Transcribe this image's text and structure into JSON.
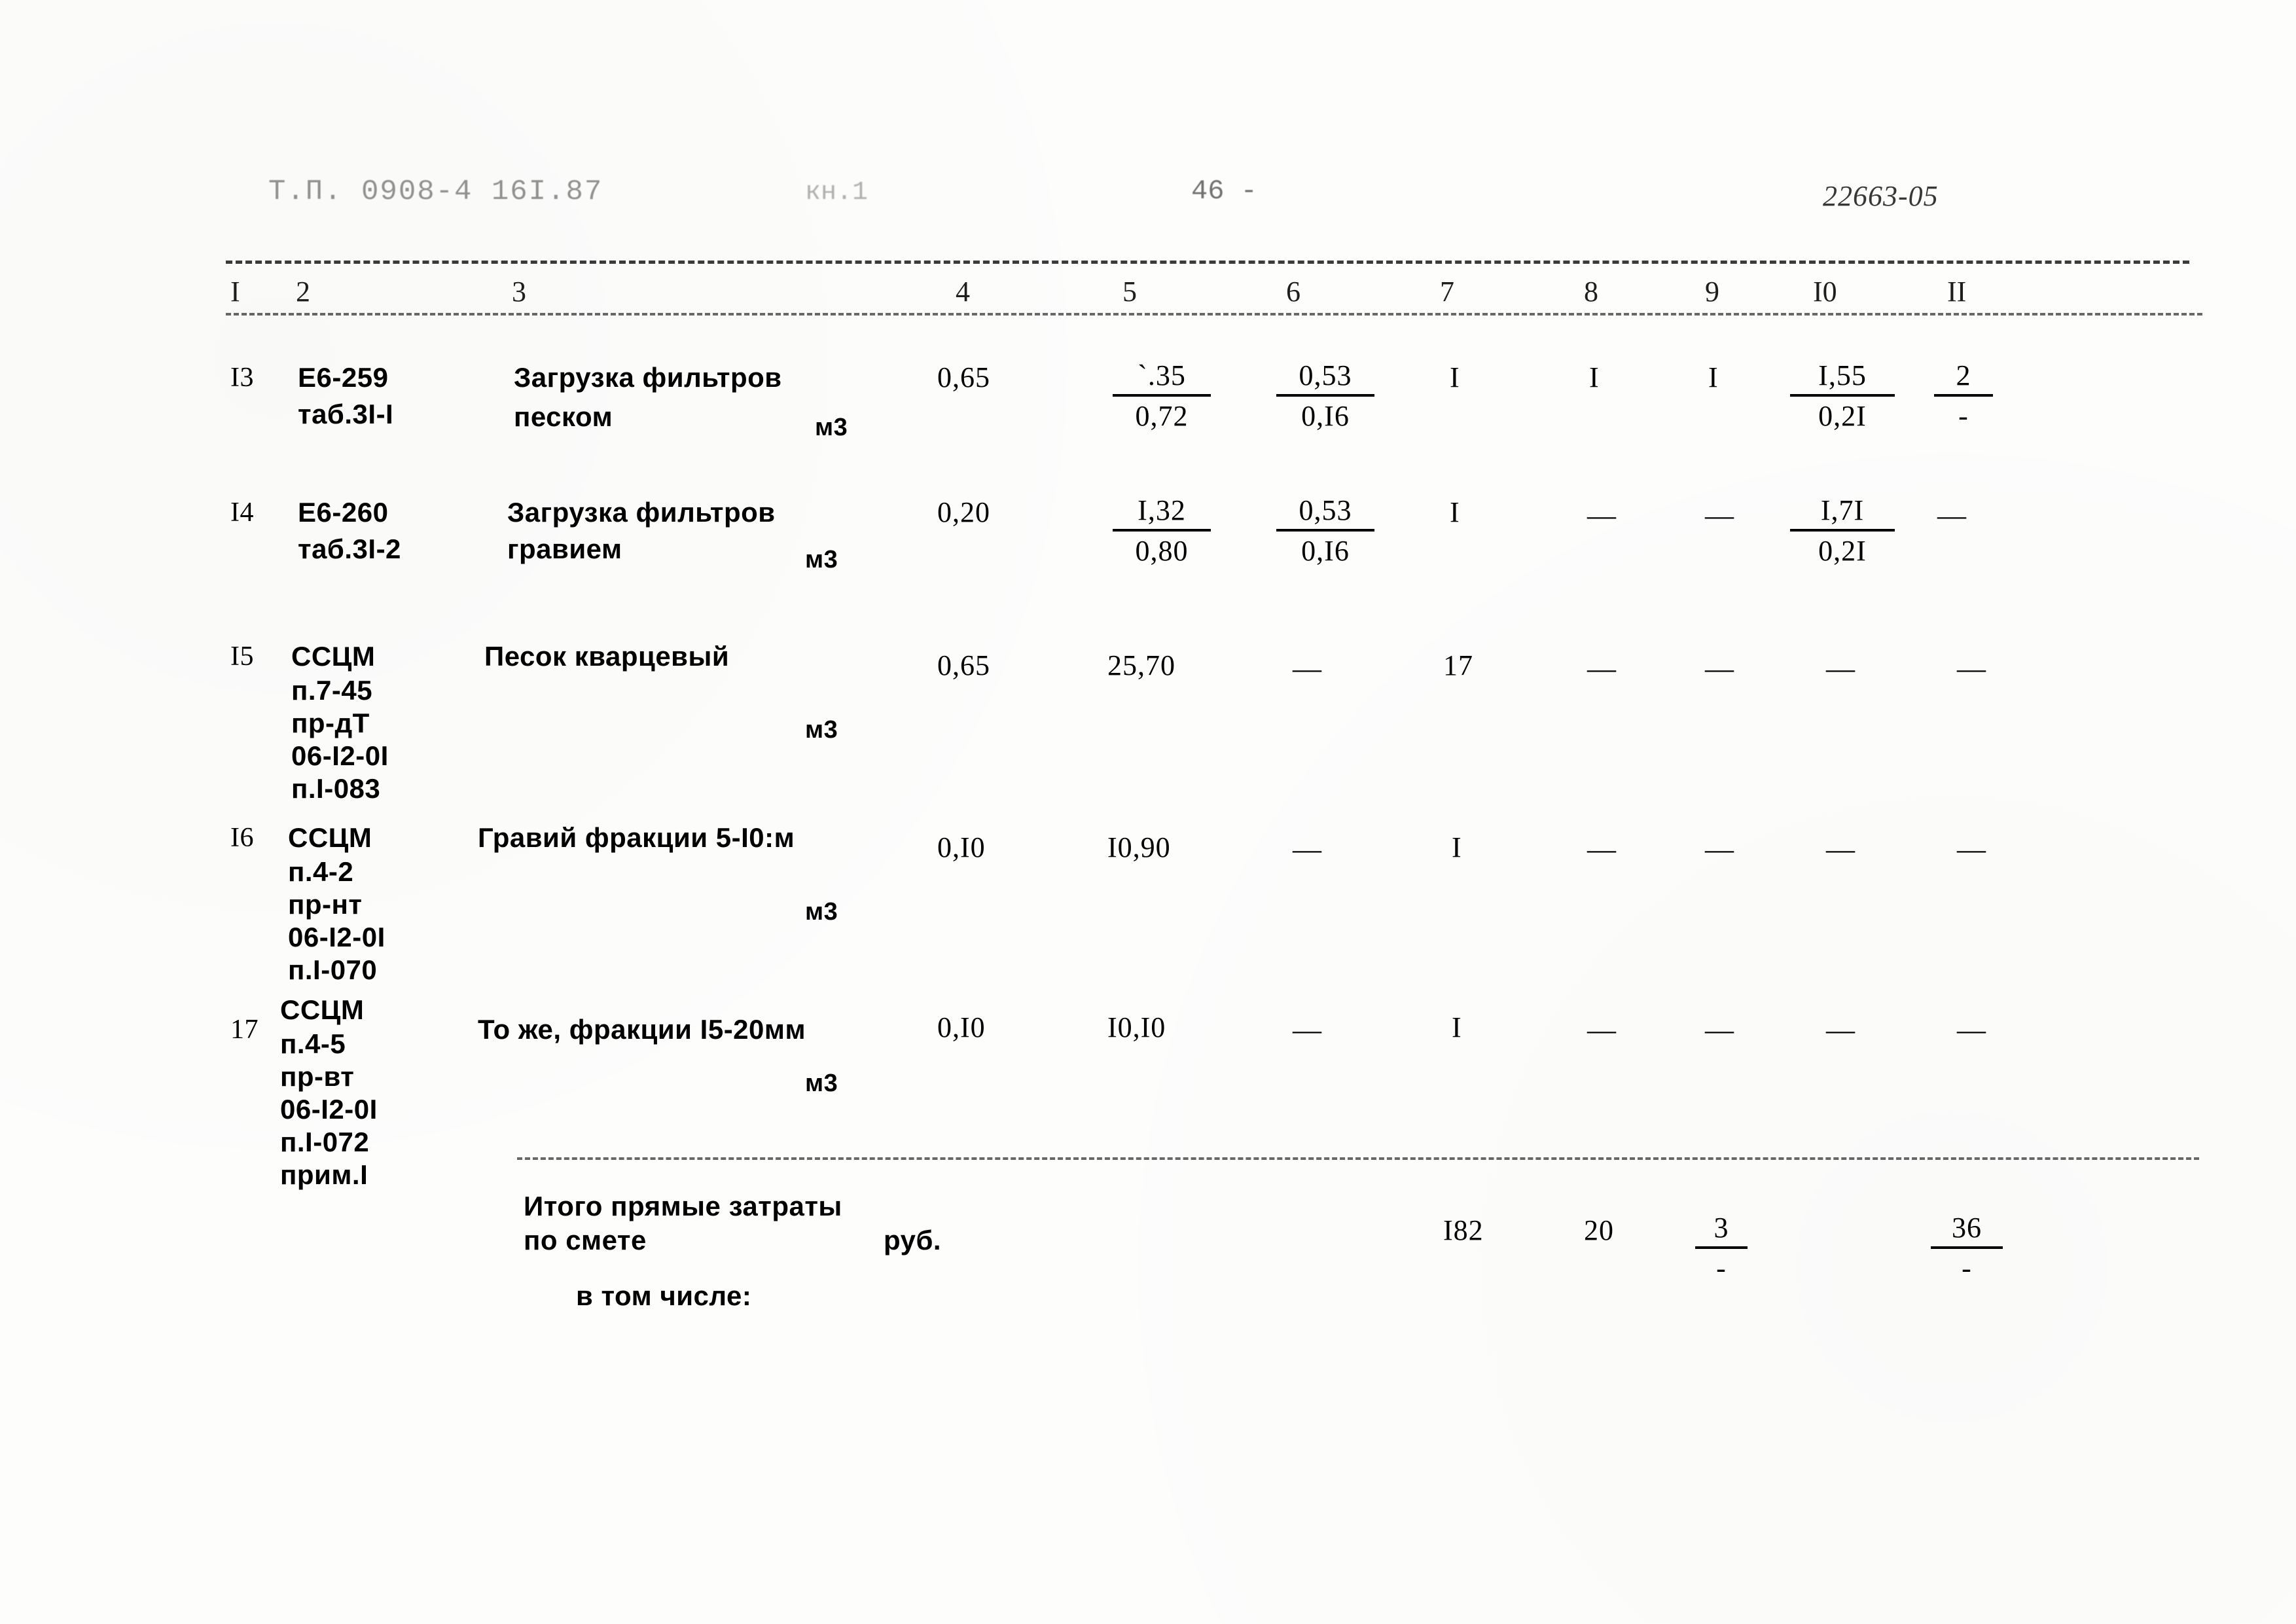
{
  "document": {
    "header_left": "Т.П. 0908-4 16I.87",
    "header_book": "кн.1",
    "header_page": "46 -",
    "header_code": "22663-05"
  },
  "table": {
    "column_numbers": [
      "I",
      "2",
      "3",
      "4",
      "5",
      "6",
      "7",
      "8",
      "9",
      "I0",
      "II"
    ],
    "rows": [
      {
        "no": "I3",
        "code_line1": "Е6-259",
        "code_line2": "таб.3I-I",
        "desc_line1": "Загрузка фильтров",
        "desc_line2": "песком",
        "unit": "м3",
        "c4": "0,65",
        "c5_top": "`.35",
        "c5_bot": "0,72",
        "c6_top": "0,53",
        "c6_bot": "0,I6",
        "c7": "I",
        "c8": "I",
        "c9": "I",
        "c10_top": "I,55",
        "c10_bot": "0,2I",
        "c11_top": "2",
        "c11_bot": "-"
      },
      {
        "no": "I4",
        "code_line1": "Е6-260",
        "code_line2": "таб.3I-2",
        "desc_line1": "Загрузка фильтров",
        "desc_line2": "гравием",
        "unit": "м3",
        "c4": "0,20",
        "c5_top": "I,32",
        "c5_bot": "0,80",
        "c6_top": "0,53",
        "c6_bot": "0,I6",
        "c7": "I",
        "c8": "—",
        "c9": "—",
        "c10_top": "I,7I",
        "c10_bot": "0,2I",
        "c11_top": "—",
        "c11_bot": ""
      },
      {
        "no": "I5",
        "code_lines": [
          "ССЦМ",
          "п.7-45",
          "пр-дТ",
          "06-I2-0I",
          "п.I-083"
        ],
        "desc_line1": "Песок кварцевый",
        "unit": "м3",
        "c4": "0,65",
        "c5": "25,70",
        "c6": "—",
        "c7": "17",
        "c8": "—",
        "c9": "—",
        "c10": "—",
        "c11": "—"
      },
      {
        "no": "I6",
        "code_lines": [
          "ССЦМ",
          "п.4-2",
          "пр-нт",
          "06-I2-0I",
          "п.I-070"
        ],
        "desc_line1": "Гравий фракции 5-I0:м",
        "unit": "м3",
        "c4": "0,I0",
        "c5": "I0,90",
        "c6": "—",
        "c7": "I",
        "c8": "—",
        "c9": "—",
        "c10": "—",
        "c11": "—"
      },
      {
        "no": "17",
        "code_lines": [
          "ССЦМ",
          "п.4-5",
          "пр-вт",
          "06-I2-0I",
          "п.I-072",
          "прим.I"
        ],
        "desc_line1": "То же, фракции I5-20мм",
        "unit": "м3",
        "c4": "0,I0",
        "c5": "I0,I0",
        "c6": "—",
        "c7": "I",
        "c8": "—",
        "c9": "—",
        "c10": "—",
        "c11": "—"
      }
    ],
    "totals": {
      "label_line1": "Итого прямые затраты",
      "label_line2": "по смете",
      "unit": "руб.",
      "c7": "I82",
      "c8": "20",
      "c9_top": "3",
      "c9_bot": "-",
      "c11_top": "36",
      "c11_bot": "-",
      "note": "в том числе:"
    }
  }
}
